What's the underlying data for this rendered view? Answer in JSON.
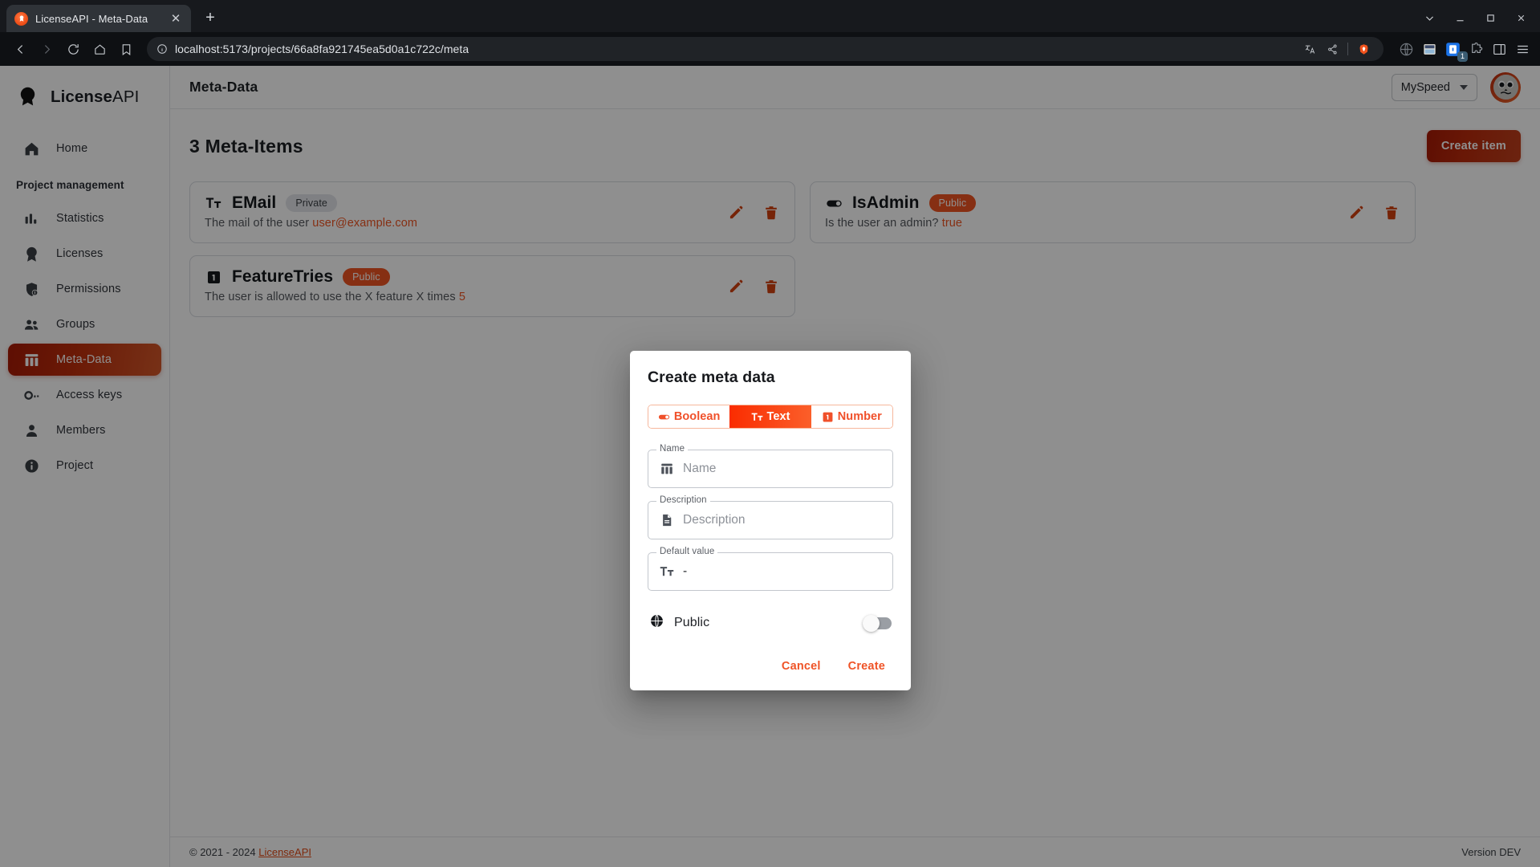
{
  "browser": {
    "tab": {
      "title": "LicenseAPI - Meta-Data",
      "favicon": "licenseapi-favicon",
      "close": "✕"
    },
    "new_tab_label": "+",
    "url": "localhost:5173/projects/66a8fa921745ea5d0a1c722c/meta",
    "extension_badge": "1"
  },
  "sidebar": {
    "brand": {
      "bold": "License",
      "rest": "API"
    },
    "home": {
      "label": "Home",
      "icon": "home-icon"
    },
    "section_label": "Project management",
    "items": [
      {
        "label": "Statistics",
        "icon": "statistics-icon",
        "active": false
      },
      {
        "label": "Licenses",
        "icon": "license-badge-icon",
        "active": false
      },
      {
        "label": "Permissions",
        "icon": "shield-lock-icon",
        "active": false
      },
      {
        "label": "Groups",
        "icon": "groups-icon",
        "active": false
      },
      {
        "label": "Meta-Data",
        "icon": "meta-data-icon",
        "active": true
      },
      {
        "label": "Access keys",
        "icon": "key-icon",
        "active": false
      },
      {
        "label": "Members",
        "icon": "person-icon",
        "active": false
      },
      {
        "label": "Project",
        "icon": "info-icon",
        "active": false
      }
    ]
  },
  "topbar": {
    "title": "Meta-Data",
    "project_selector": "MySpeed",
    "avatar": "user-avatar"
  },
  "page": {
    "title": "3 Meta-Items",
    "create_button": "Create item"
  },
  "cards": [
    {
      "name": "EMail",
      "type_icon": "text-type-icon",
      "badge": "Private",
      "badge_style": "private",
      "description": "The mail of the user",
      "value": "user@example.com"
    },
    {
      "name": "IsAdmin",
      "type_icon": "boolean-type-icon",
      "badge": "Public",
      "badge_style": "public",
      "description": "Is the user an admin?",
      "value": "true"
    },
    {
      "name": "FeatureTries",
      "type_icon": "number-type-icon",
      "badge": "Public",
      "badge_style": "public",
      "description": "The user is allowed to use the X feature X times",
      "value": "5"
    }
  ],
  "card_actions": {
    "edit": "edit-pencil-icon",
    "delete": "trash-icon"
  },
  "modal": {
    "title": "Create meta data",
    "types": [
      {
        "label": "Boolean",
        "icon": "boolean-type-icon",
        "selected": false
      },
      {
        "label": "Text",
        "icon": "text-type-icon",
        "selected": true
      },
      {
        "label": "Number",
        "icon": "number-type-icon",
        "selected": false
      }
    ],
    "fields": {
      "name": {
        "legend": "Name",
        "placeholder": "Name",
        "value": "",
        "icon": "meta-data-icon"
      },
      "description": {
        "legend": "Description",
        "placeholder": "Description",
        "value": "",
        "icon": "document-icon"
      },
      "default": {
        "legend": "Default value",
        "value": "-",
        "icon": "text-type-icon"
      }
    },
    "public": {
      "label": "Public",
      "icon": "globe-icon",
      "on": false
    },
    "cancel": "Cancel",
    "create": "Create"
  },
  "footer": {
    "copyright": "© 2021 - 2024",
    "link": "LicenseAPI",
    "version": "Version DEV"
  },
  "colors": {
    "accent": "#ef5522",
    "accent_dark": "#a81a06",
    "sidebar_active_start": "#a81a06",
    "sidebar_active_end": "#d4582a"
  }
}
